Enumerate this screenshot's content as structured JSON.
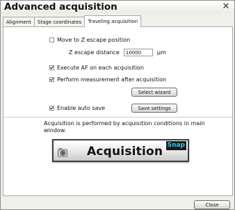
{
  "window": {
    "title": "Advanced acquisition",
    "close_symbol": "✕"
  },
  "tabs": [
    {
      "label": "Alignment"
    },
    {
      "label": "Stage coordinates"
    },
    {
      "label": "Traveling acquisition",
      "active": true
    }
  ],
  "panel": {
    "move_to_z_escape": {
      "label": "Move to Z escape position",
      "checked": false
    },
    "z_escape_distance": {
      "label": "Z escape distance",
      "value": "10000",
      "unit": "µm"
    },
    "execute_af": {
      "label": "Execute AF on each acquisition",
      "checked": true
    },
    "perform_measurement": {
      "label": "Perform measurement after acquisition",
      "checked": true
    },
    "select_wizard_label": "Select wizard",
    "enable_auto_save": {
      "label": "Enable auto save",
      "checked": true
    },
    "save_settings_label": "Save settings",
    "note": "Acquisition is performed by acquisition conditions in main window.",
    "acquisition_button": {
      "label": "Acquisition",
      "badge": "Snap",
      "icon": "camera-icon"
    }
  },
  "footer": {
    "close_label": "Close"
  },
  "colors": {
    "snap_badge_text": "#29c8f0",
    "snap_badge_bg": "#1a1a1a",
    "window_bg": "#f0efe9"
  }
}
